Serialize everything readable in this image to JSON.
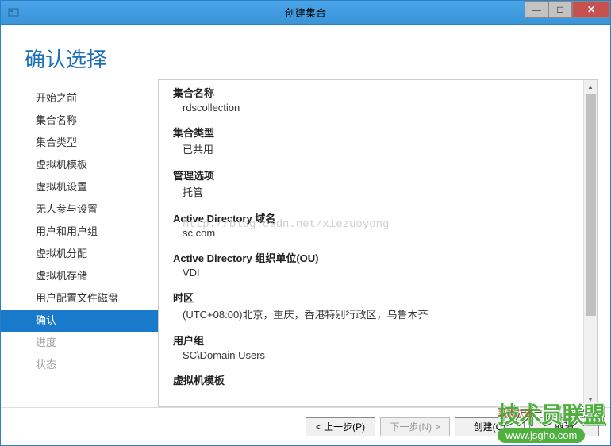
{
  "window": {
    "title": "创建集合"
  },
  "heading": "确认选择",
  "sidebar": {
    "items": [
      {
        "label": "开始之前",
        "state": "normal"
      },
      {
        "label": "集合名称",
        "state": "normal"
      },
      {
        "label": "集合类型",
        "state": "normal"
      },
      {
        "label": "虚拟机模板",
        "state": "normal"
      },
      {
        "label": "虚拟机设置",
        "state": "normal"
      },
      {
        "label": "无人参与设置",
        "state": "normal"
      },
      {
        "label": "用户和用户组",
        "state": "normal"
      },
      {
        "label": "虚拟机分配",
        "state": "normal"
      },
      {
        "label": "虚拟机存储",
        "state": "normal"
      },
      {
        "label": "用户配置文件磁盘",
        "state": "normal"
      },
      {
        "label": "确认",
        "state": "active"
      },
      {
        "label": "进度",
        "state": "disabled"
      },
      {
        "label": "状态",
        "state": "disabled"
      }
    ]
  },
  "details": {
    "sections": [
      {
        "label": "集合名称",
        "value": "rdscollection"
      },
      {
        "label": "集合类型",
        "value": "已共用"
      },
      {
        "label": "管理选项",
        "value": "托管"
      },
      {
        "label": "Active Directory 域名",
        "value": "sc.com"
      },
      {
        "label": "Active Directory 组织单位(OU)",
        "value": "VDI"
      },
      {
        "label": "时区",
        "value": "(UTC+08:00)北京，重庆，香港特别行政区，乌鲁木齐"
      },
      {
        "label": "用户组",
        "value": "SC\\Domain Users"
      },
      {
        "label": "虚拟机模板",
        "value": ""
      }
    ]
  },
  "watermark": "http://blog.csdn.net/xiezuoyong",
  "footer": {
    "prev": "< 上一步(P)",
    "next": "下一步(N) >",
    "create": "创建(C)",
    "cancel": "取消"
  },
  "overlay": {
    "brand": "技术员联盟",
    "url": "www.jsgho.com",
    "small": "红黑联盟"
  }
}
